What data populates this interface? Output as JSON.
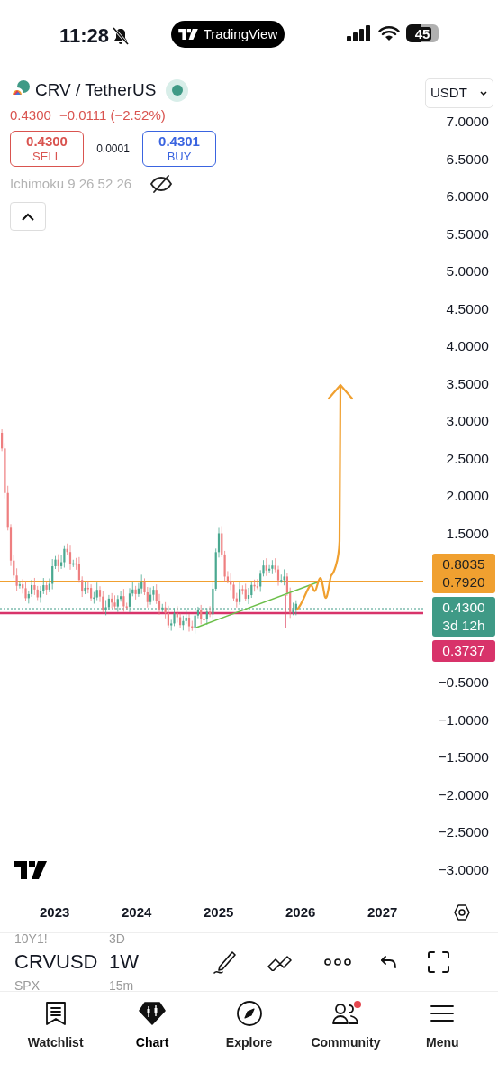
{
  "status_bar": {
    "time": "11:28",
    "silent": true,
    "app_pill": "TradingView",
    "battery": "45"
  },
  "symbol": {
    "name": "CRV / TetherUS",
    "market_open": true
  },
  "quote": {
    "last": "0.4300",
    "change": "−0.0111",
    "change_pct": "(−2.52%)"
  },
  "trade": {
    "sell_price": "0.4300",
    "sell_label": "SELL",
    "spread": "0.0001",
    "buy_price": "0.4301",
    "buy_label": "BUY"
  },
  "indicator": {
    "name": "Ichimoku 9 26 52 26",
    "hidden": true
  },
  "currency": "USDT",
  "price_scale": {
    "upper": [
      "7.0000",
      "6.5000",
      "6.0000",
      "5.5000",
      "5.0000",
      "4.5000",
      "4.0000",
      "3.5000",
      "3.0000",
      "2.5000",
      "2.0000",
      "1.5000"
    ],
    "tags": [
      {
        "lines": [
          "0.8035",
          "0.7920"
        ],
        "color": "#f0a030"
      },
      {
        "lines": [
          "0.4300",
          "3d 12h"
        ],
        "color": "#3f9a86"
      },
      {
        "lines": [
          "0.3737"
        ],
        "color": "#d8336a"
      }
    ],
    "lower": [
      "−0.5000",
      "−1.0000",
      "−1.5000",
      "−2.0000",
      "−2.5000",
      "−3.0000"
    ]
  },
  "time_axis": [
    "2023",
    "2024",
    "2025",
    "2026",
    "2027"
  ],
  "toolbar": {
    "symbol": "CRVUSD",
    "symbol_prev": "10Y1!",
    "symbol_next": "SPX",
    "interval": "1W",
    "interval_prev": "3D",
    "interval_next": "15m"
  },
  "nav": [
    {
      "label": "Watchlist",
      "kind": "watchlist",
      "selected": false,
      "badge": false
    },
    {
      "label": "Chart",
      "kind": "chart",
      "selected": true,
      "badge": false
    },
    {
      "label": "Explore",
      "kind": "explore",
      "selected": false,
      "badge": false
    },
    {
      "label": "Community",
      "kind": "community",
      "selected": false,
      "badge": true
    },
    {
      "label": "Menu",
      "kind": "menu",
      "selected": false,
      "badge": false
    }
  ]
}
